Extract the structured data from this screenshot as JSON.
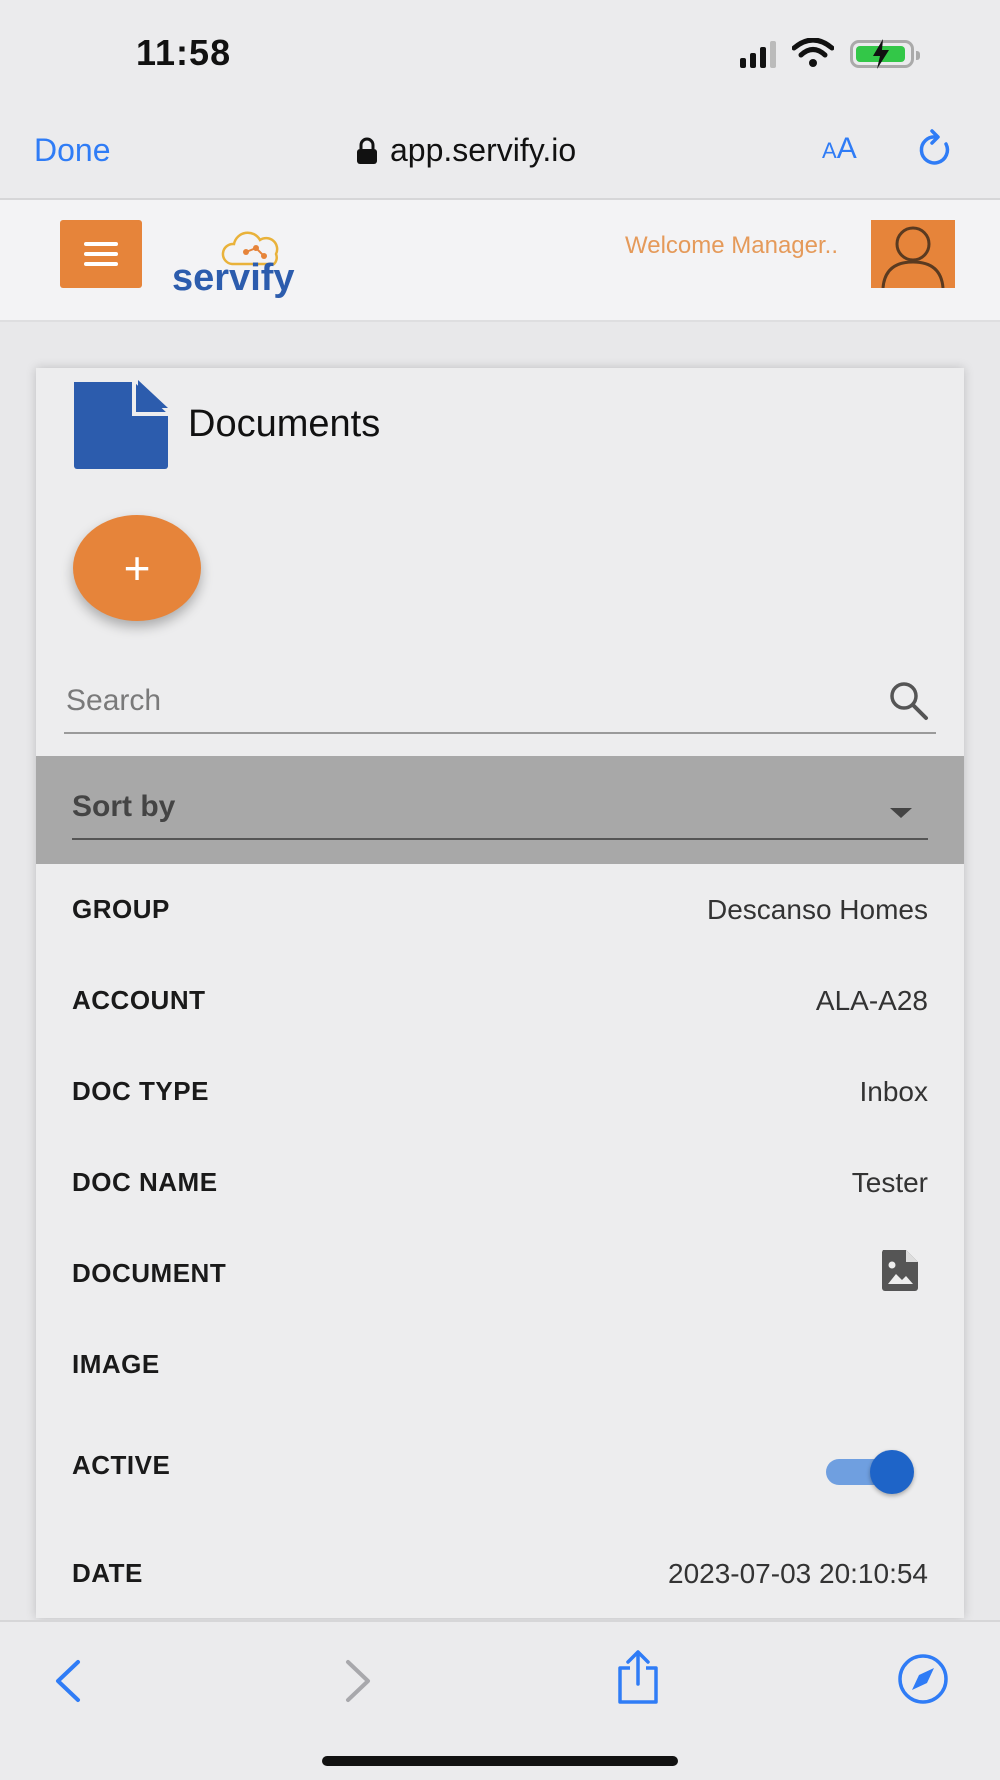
{
  "status_bar": {
    "time": "11:58",
    "icons": [
      "signal-icon",
      "wifi-icon",
      "battery-charging-icon"
    ],
    "battery_color": "#33c748"
  },
  "browser": {
    "done_label": "Done",
    "url": "app.servify.io",
    "text_size_label_small": "A",
    "text_size_label_large": "A",
    "accent_color": "#2f7cf6"
  },
  "header": {
    "logo_text": "servify",
    "welcome_text": "Welcome Manager..",
    "brand_color": "#e6843a"
  },
  "page": {
    "title": "Documents",
    "add_label": "+",
    "search_placeholder": "Search",
    "sort_label": "Sort by"
  },
  "details": [
    {
      "label": "GROUP",
      "value": "Descanso Homes"
    },
    {
      "label": "ACCOUNT",
      "value": "ALA-A28"
    },
    {
      "label": "DOC TYPE",
      "value": "Inbox"
    },
    {
      "label": "DOC NAME",
      "value": "Tester"
    },
    {
      "label": "DOCUMENT",
      "value": "",
      "icon": "document-image-icon"
    },
    {
      "label": "IMAGE",
      "value": ""
    },
    {
      "label": "ACTIVE",
      "toggle": true
    },
    {
      "label": "DATE",
      "value": "2023-07-03 20:10:54"
    }
  ]
}
